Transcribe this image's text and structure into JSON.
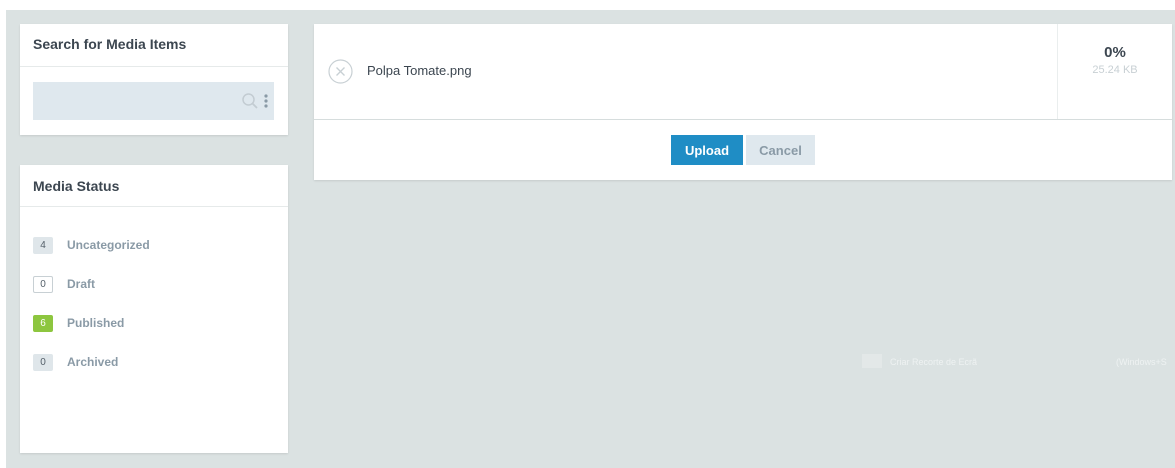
{
  "search_panel": {
    "title": "Search for Media Items",
    "query": "",
    "placeholder": ""
  },
  "status_panel": {
    "title": "Media Status",
    "items": [
      {
        "count": "4",
        "label": "Uncategorized",
        "badge_style": "filled"
      },
      {
        "count": "0",
        "label": "Draft",
        "badge_style": "outline"
      },
      {
        "count": "6",
        "label": "Published",
        "badge_style": "green"
      },
      {
        "count": "0",
        "label": "Archived",
        "badge_style": "filled"
      }
    ]
  },
  "upload_panel": {
    "file_name": "Polpa Tomate.png",
    "progress_percent": 0,
    "progress_label": "0%",
    "file_size": "25.24 KB",
    "upload_label": "Upload",
    "cancel_label": "Cancel"
  },
  "overlay": {
    "snip_label": "Criar Recorte de Ecrã",
    "shortcut_label": "(Windows+S"
  },
  "colors": {
    "background": "#dbe2e2",
    "primary_button": "#1f8dc5",
    "published_badge": "#8dc63f",
    "muted_text": "#8a9aa6"
  },
  "icons": {
    "search": "search-icon",
    "more": "kebab-menu-icon",
    "remove": "close-circle-icon"
  }
}
